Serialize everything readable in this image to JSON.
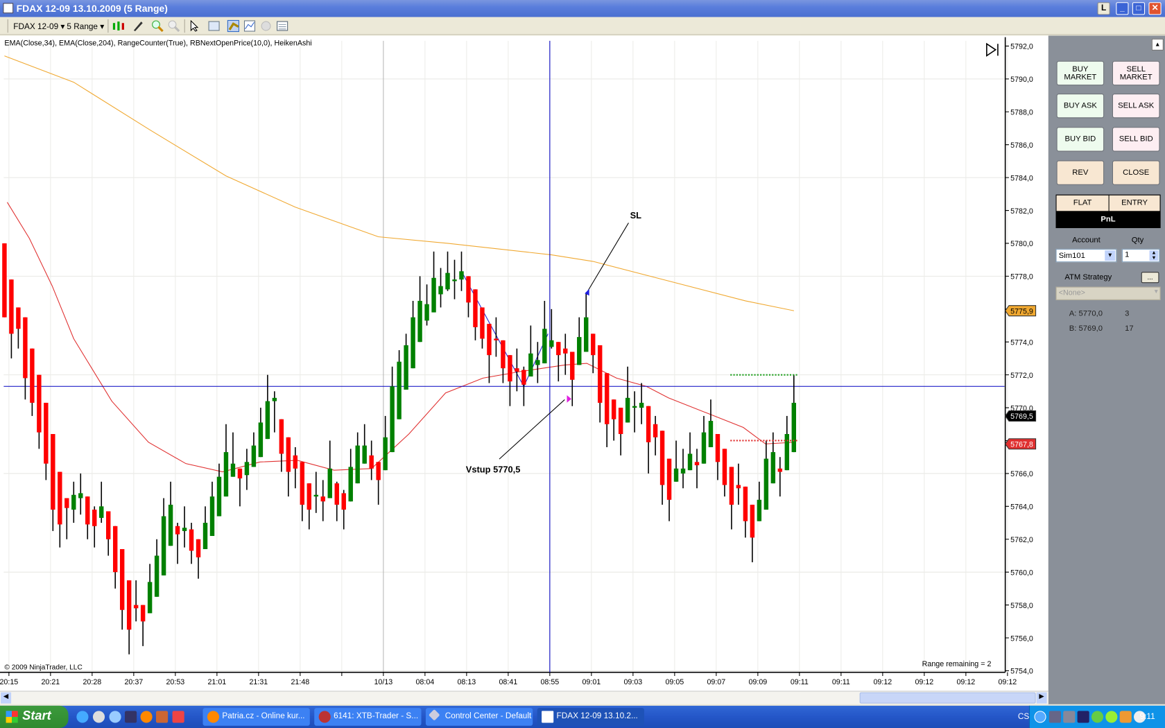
{
  "window": {
    "title": "FDAX 12-09  13.10.2009 (5 Range)",
    "btn_l": "L",
    "btn_min": "_",
    "btn_max": "□",
    "btn_close": "✕"
  },
  "toolbar": {
    "instrument": "FDAX 12-09",
    "period": "5 Range",
    "icons": [
      "candlestick-style-icon",
      "drawing-pencil-icon",
      "zoom-in-icon",
      "zoom-out-icon",
      "pointer-icon",
      "data-box-icon",
      "chart-trader-icon",
      "indicators-icon",
      "strategy-icon",
      "properties-icon"
    ]
  },
  "chart": {
    "indicators_label": "EMA(Close,34), EMA(Close,204), RangeCounter(True), RBNextOpenPrice(10,0), HeikenAshi",
    "copyright": "© 2009 NinjaTrader, LLC",
    "range_remaining": "Range remaining = 2",
    "annotation_sl": "SL",
    "annotation_entry": "Vstup 5770,5",
    "price_label_ema204": "5775,9",
    "price_label_last": "5769,5",
    "price_label_stop": "5767,8",
    "crosshair_price": 5771.3,
    "target_line": 5772.0,
    "stop_line": 5768.0,
    "colors": {
      "up": "#008000",
      "down": "#ff0000",
      "ema34": "#e03030",
      "ema204": "#f0a830",
      "crosshair": "#0000c0"
    },
    "y_ticks": [
      "5792,0",
      "5790,0",
      "5788,0",
      "5786,0",
      "5784,0",
      "5782,0",
      "5780,0",
      "5778,0",
      "5776,0",
      "5774,0",
      "5772,0",
      "5770,0",
      "5768,0",
      "5766,0",
      "5764,0",
      "5762,0",
      "5760,0",
      "5758,0",
      "5756,0",
      "5754,0"
    ],
    "x_ticks": [
      "20:15",
      "20:21",
      "20:28",
      "20:37",
      "20:53",
      "21:01",
      "21:31",
      "21:48",
      "",
      "10/13",
      "08:04",
      "08:13",
      "08:41",
      "08:55",
      "09:01",
      "09:03",
      "09:05",
      "09:07",
      "09:09",
      "09:11",
      "09:11",
      "09:12",
      "09:12",
      "09:12",
      "09:12"
    ],
    "candles": [
      [
        5780,
        5780,
        5775.5,
        5775.5
      ],
      [
        5777.8,
        5777.8,
        5773,
        5774.5
      ],
      [
        5776.1,
        5776.1,
        5773.6,
        5774.8
      ],
      [
        5775.5,
        5775.5,
        5770.5,
        5771.8
      ],
      [
        5773.6,
        5773.6,
        5769.5,
        5770.3
      ],
      [
        5772,
        5772,
        5767.5,
        5768.5
      ],
      [
        5770.3,
        5770.3,
        5765.6,
        5766.6
      ],
      [
        5768.4,
        5768.4,
        5762.5,
        5763.8
      ],
      [
        5766.1,
        5766.1,
        5761.5,
        5762.9
      ],
      [
        5764.5,
        5764.5,
        5762,
        5763.9
      ],
      [
        5763.8,
        5765.5,
        5763,
        5764.7
      ],
      [
        5764.5,
        5766,
        5763.5,
        5764.8
      ],
      [
        5764.6,
        5764.6,
        5762,
        5762.9
      ],
      [
        5763.8,
        5764,
        5761.5,
        5762.8
      ],
      [
        5763.3,
        5765.5,
        5763,
        5764
      ],
      [
        5763.7,
        5763.7,
        5761,
        5762
      ],
      [
        5762.8,
        5762.8,
        5759,
        5760
      ],
      [
        5761.4,
        5761.4,
        5756.5,
        5757.7
      ],
      [
        5759.5,
        5759.5,
        5755,
        5756.5
      ],
      [
        5758,
        5759.5,
        5757,
        5757.8
      ],
      [
        5758,
        5758,
        5755.5,
        5757
      ],
      [
        5757.5,
        5760.5,
        5757.5,
        5759.4
      ],
      [
        5758.5,
        5762,
        5758.5,
        5761
      ],
      [
        5759.8,
        5764.5,
        5759.8,
        5763.4
      ],
      [
        5761.6,
        5765.5,
        5761.6,
        5764.1
      ],
      [
        5762.8,
        5763,
        5760.5,
        5762.3
      ],
      [
        5762.5,
        5764,
        5761.5,
        5762.7
      ],
      [
        5762.6,
        5763,
        5760.5,
        5761.3
      ],
      [
        5762,
        5762,
        5759.6,
        5760.9
      ],
      [
        5761.4,
        5764,
        5761.4,
        5763
      ],
      [
        5762.2,
        5765.5,
        5762.2,
        5764.6
      ],
      [
        5763.4,
        5766.6,
        5763.4,
        5765.8
      ],
      [
        5764.6,
        5769,
        5764.6,
        5767.3
      ],
      [
        5765.8,
        5768.5,
        5765.8,
        5766.6
      ],
      [
        5766.3,
        5766.3,
        5764,
        5765.7
      ],
      [
        5765.9,
        5767.5,
        5765,
        5766.7
      ],
      [
        5766.4,
        5768.5,
        5766.4,
        5767.7
      ],
      [
        5767,
        5770,
        5767,
        5769.1
      ],
      [
        5768.1,
        5772,
        5768.1,
        5770.4
      ],
      [
        5770.4,
        5771,
        5768.5,
        5770.6
      ],
      [
        5769.3,
        5769.3,
        5766.1,
        5767.2
      ],
      [
        5768.2,
        5768.2,
        5764.6,
        5766.1
      ],
      [
        5767.1,
        5767.6,
        5765.1,
        5766.3
      ],
      [
        5766.7,
        5766.7,
        5763.1,
        5764.1
      ],
      [
        5765.4,
        5765.4,
        5762.6,
        5763.8
      ],
      [
        5764.6,
        5766.1,
        5763.6,
        5764.7
      ],
      [
        5764.6,
        5765.6,
        5763.1,
        5764.3
      ],
      [
        5764.5,
        5768,
        5764.5,
        5766.3
      ],
      [
        5765.4,
        5765.5,
        5763.1,
        5764.1
      ],
      [
        5764.8,
        5765,
        5762.6,
        5763.8
      ],
      [
        5764.3,
        5767.5,
        5764.3,
        5766.4
      ],
      [
        5765.4,
        5768.5,
        5765.4,
        5767.7
      ],
      [
        5766.6,
        5769,
        5766.6,
        5767.7
      ],
      [
        5767.1,
        5768,
        5765.6,
        5766.3
      ],
      [
        5766.7,
        5766.7,
        5764.1,
        5765.6
      ],
      [
        5766.2,
        5769.5,
        5766.2,
        5768.2
      ],
      [
        5767.3,
        5772.5,
        5767.3,
        5771.3
      ],
      [
        5769.3,
        5773.5,
        5769.3,
        5772.8
      ],
      [
        5771.1,
        5774.5,
        5771.1,
        5773.8
      ],
      [
        5772.4,
        5776.5,
        5772.4,
        5775.5
      ],
      [
        5774,
        5778,
        5774,
        5776.5
      ],
      [
        5775.3,
        5777.5,
        5775,
        5776.3
      ],
      [
        5775.8,
        5779.5,
        5775.8,
        5777.9
      ],
      [
        5776.9,
        5778.5,
        5776.1,
        5777.4
      ],
      [
        5777.2,
        5779.5,
        5777.1,
        5778.2
      ],
      [
        5777.7,
        5779,
        5776.6,
        5777.8
      ],
      [
        5777.8,
        5779.5,
        5777.1,
        5778.3
      ],
      [
        5778,
        5778,
        5775.5,
        5776.4
      ],
      [
        5777.2,
        5777.2,
        5774.1,
        5774.9
      ],
      [
        5776.1,
        5776.1,
        5773.6,
        5774.2
      ],
      [
        5775.1,
        5775.1,
        5771.5,
        5773.2
      ],
      [
        5774.2,
        5775.5,
        5773.1,
        5774.1
      ],
      [
        5774.1,
        5774.1,
        5771.5,
        5772.4
      ],
      [
        5773.2,
        5773.2,
        5770.1,
        5771.6
      ],
      [
        5772.4,
        5773.6,
        5771,
        5772.2
      ],
      [
        5772.3,
        5772.5,
        5770.1,
        5771.4
      ],
      [
        5771.9,
        5775,
        5771.9,
        5773.3
      ],
      [
        5772.6,
        5774,
        5771.5,
        5772.9
      ],
      [
        5772.7,
        5776.5,
        5772.7,
        5774.8
      ],
      [
        5773.7,
        5776,
        5773.6,
        5774.1
      ],
      [
        5774,
        5774,
        5771.6,
        5773.2
      ],
      [
        5773.6,
        5774.5,
        5772,
        5773.3
      ],
      [
        5773.4,
        5773.4,
        5770.1,
        5771.7
      ],
      [
        5772.6,
        5775.5,
        5772.6,
        5774.3
      ],
      [
        5773.4,
        5777,
        5773.4,
        5775.5
      ],
      [
        5774.5,
        5774.5,
        5772.1,
        5773.2
      ],
      [
        5773.8,
        5773.8,
        5769.1,
        5770.3
      ],
      [
        5772.1,
        5772.1,
        5767.6,
        5769
      ],
      [
        5770.5,
        5770.5,
        5768,
        5769.3
      ],
      [
        5770,
        5770,
        5767.1,
        5768.4
      ],
      [
        5769.1,
        5772.5,
        5769.1,
        5770.6
      ],
      [
        5770,
        5771,
        5768.5,
        5770.1
      ],
      [
        5770,
        5771.5,
        5769,
        5770.3
      ],
      [
        5770.1,
        5770.1,
        5766,
        5767.9
      ],
      [
        5769,
        5769.5,
        5767.1,
        5768.2
      ],
      [
        5768.6,
        5768.6,
        5764.1,
        5765.3
      ],
      [
        5766.9,
        5766.9,
        5763.1,
        5764.4
      ],
      [
        5765.5,
        5768,
        5765.5,
        5766.3
      ],
      [
        5766,
        5767.5,
        5765.1,
        5766.3
      ],
      [
        5766.2,
        5768.5,
        5766.2,
        5767.2
      ],
      [
        5766.7,
        5767.5,
        5765.1,
        5766.5
      ],
      [
        5766.6,
        5769.5,
        5766.6,
        5768.5
      ],
      [
        5767.6,
        5770.5,
        5767.6,
        5769.2
      ],
      [
        5768.4,
        5768.4,
        5765.6,
        5766.7
      ],
      [
        5767.5,
        5767.5,
        5764.6,
        5765.3
      ],
      [
        5766.4,
        5766.4,
        5762.6,
        5764.1
      ],
      [
        5765.3,
        5766.6,
        5764.1,
        5765.1
      ],
      [
        5765.2,
        5765.2,
        5762.1,
        5763.1
      ],
      [
        5764.1,
        5764.1,
        5760.6,
        5762.1
      ],
      [
        5763.1,
        5765.5,
        5763.1,
        5764.4
      ],
      [
        5763.8,
        5768,
        5763.8,
        5766.9
      ],
      [
        5765.4,
        5768.5,
        5765.4,
        5767.3
      ],
      [
        5766.3,
        5767,
        5764.6,
        5766.1
      ],
      [
        5766.2,
        5769.5,
        5766.2,
        5768.4
      ],
      [
        5767.3,
        5772,
        5767.3,
        5770.3
      ]
    ],
    "ema34": [
      [
        0.4,
        5782.5
      ],
      [
        3.6,
        5780.3
      ],
      [
        6.9,
        5777.4
      ],
      [
        10,
        5774.2
      ],
      [
        15.5,
        5770.4
      ],
      [
        20.8,
        5767.9
      ],
      [
        26.2,
        5766.6
      ],
      [
        31.5,
        5766.1
      ],
      [
        36.9,
        5766.7
      ],
      [
        42.3,
        5766.8
      ],
      [
        47.6,
        5766.2
      ],
      [
        53,
        5766.3
      ],
      [
        58.4,
        5768.4
      ],
      [
        63.7,
        5770.9
      ],
      [
        69.1,
        5771.8
      ],
      [
        74.5,
        5772.2
      ],
      [
        80.9,
        5772.6
      ],
      [
        84.1,
        5772.7
      ],
      [
        88.4,
        5771.8
      ],
      [
        92.7,
        5771.3
      ],
      [
        95.9,
        5770.6
      ],
      [
        101.3,
        5769.7
      ],
      [
        106.7,
        5768.8
      ],
      [
        109.9,
        5767.8
      ],
      [
        114,
        5767.9
      ]
    ],
    "ema204": [
      [
        0,
        5791.4
      ],
      [
        10,
        5789.8
      ],
      [
        21,
        5786.9
      ],
      [
        32,
        5784.1
      ],
      [
        42,
        5782.2
      ],
      [
        54,
        5780.4
      ],
      [
        64,
        5780.0
      ],
      [
        79,
        5779.3
      ],
      [
        85,
        5778.9
      ],
      [
        96,
        5777.7
      ],
      [
        107,
        5776.5
      ],
      [
        114,
        5775.9
      ]
    ]
  },
  "panel": {
    "buy_market": "BUY MARKET",
    "sell_market": "SELL MARKET",
    "buy_ask": "BUY ASK",
    "sell_ask": "SELL ASK",
    "buy_bid": "BUY BID",
    "sell_bid": "SELL BID",
    "rev": "REV",
    "close": "CLOSE",
    "flat": "FLAT",
    "entry": "ENTRY",
    "pnl": "PnL",
    "account_label": "Account",
    "qty_label": "Qty",
    "account": "Sim101",
    "qty": "1",
    "atm_label": "ATM Strategy",
    "atm_btn": "...",
    "atm_value": "<None>",
    "ask_label": "A: 5770,0",
    "ask_size": "3",
    "bid_label": "B: 5769,0",
    "bid_size": "17"
  },
  "taskbar": {
    "start": "Start",
    "tasks": [
      "Patria.cz - Online kur...",
      "6141: XTB-Trader - S...",
      "Control Center - Default",
      "FDAX 12-09  13.10.2..."
    ],
    "lang": "CS",
    "clock": "9:11"
  }
}
